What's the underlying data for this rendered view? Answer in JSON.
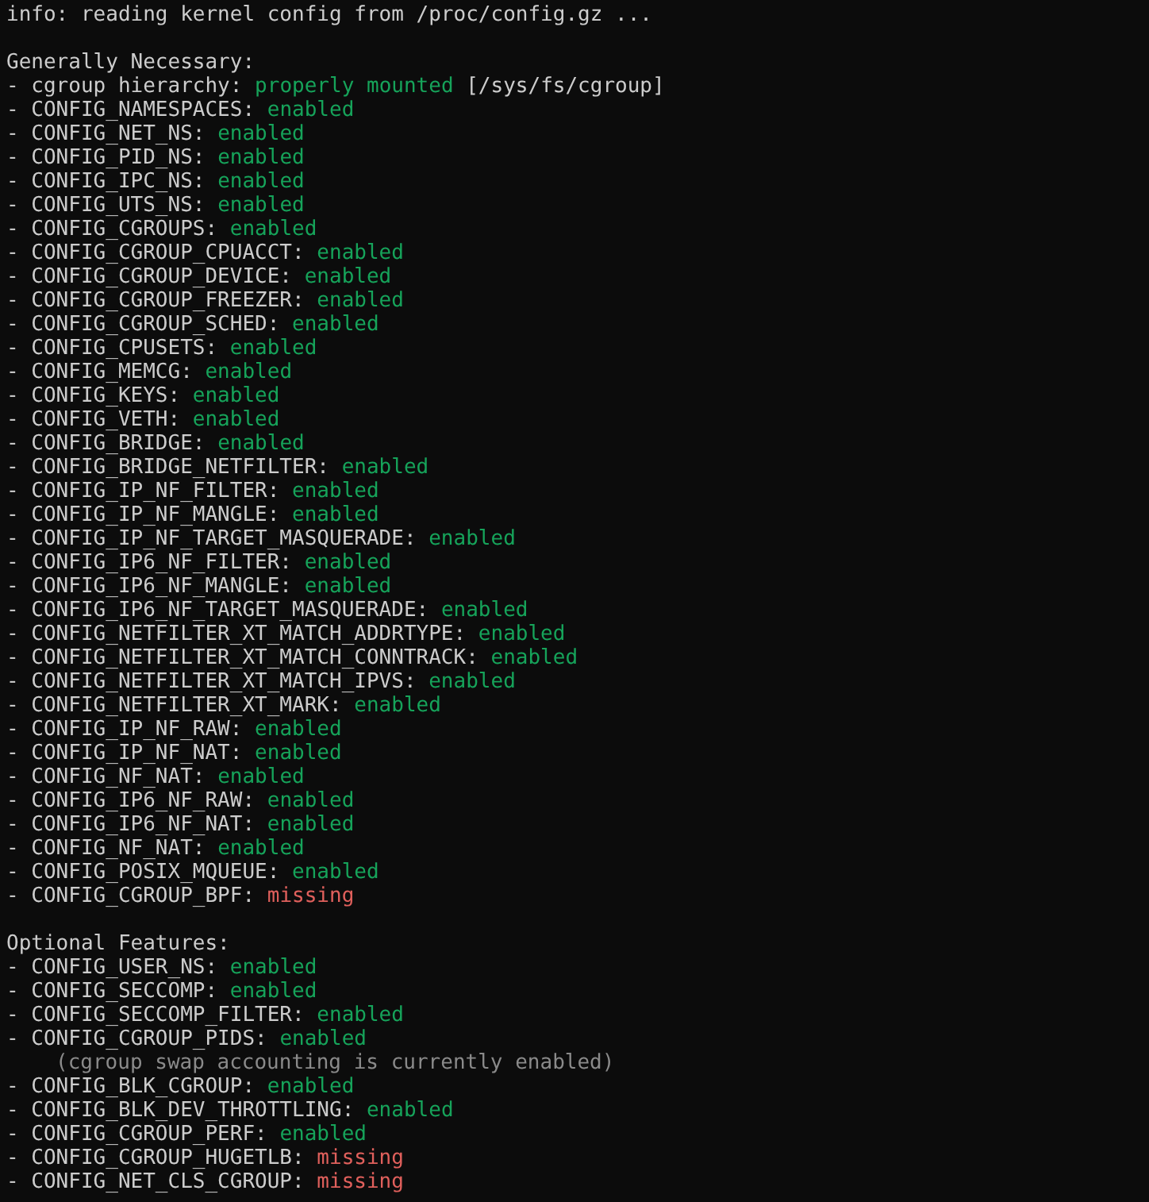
{
  "info": "info: reading kernel config from /proc/config.gz ...",
  "sections": [
    {
      "heading": "Generally Necessary:",
      "items": [
        {
          "kind": "check",
          "label": "- cgroup hierarchy:",
          "status": "properly mounted",
          "ok": true,
          "suffix": "[/sys/fs/cgroup]"
        },
        {
          "kind": "check",
          "label": "- CONFIG_NAMESPACES:",
          "status": "enabled",
          "ok": true
        },
        {
          "kind": "check",
          "label": "- CONFIG_NET_NS:",
          "status": "enabled",
          "ok": true
        },
        {
          "kind": "check",
          "label": "- CONFIG_PID_NS:",
          "status": "enabled",
          "ok": true
        },
        {
          "kind": "check",
          "label": "- CONFIG_IPC_NS:",
          "status": "enabled",
          "ok": true
        },
        {
          "kind": "check",
          "label": "- CONFIG_UTS_NS:",
          "status": "enabled",
          "ok": true
        },
        {
          "kind": "check",
          "label": "- CONFIG_CGROUPS:",
          "status": "enabled",
          "ok": true
        },
        {
          "kind": "check",
          "label": "- CONFIG_CGROUP_CPUACCT:",
          "status": "enabled",
          "ok": true
        },
        {
          "kind": "check",
          "label": "- CONFIG_CGROUP_DEVICE:",
          "status": "enabled",
          "ok": true
        },
        {
          "kind": "check",
          "label": "- CONFIG_CGROUP_FREEZER:",
          "status": "enabled",
          "ok": true
        },
        {
          "kind": "check",
          "label": "- CONFIG_CGROUP_SCHED:",
          "status": "enabled",
          "ok": true
        },
        {
          "kind": "check",
          "label": "- CONFIG_CPUSETS:",
          "status": "enabled",
          "ok": true
        },
        {
          "kind": "check",
          "label": "- CONFIG_MEMCG:",
          "status": "enabled",
          "ok": true
        },
        {
          "kind": "check",
          "label": "- CONFIG_KEYS:",
          "status": "enabled",
          "ok": true
        },
        {
          "kind": "check",
          "label": "- CONFIG_VETH:",
          "status": "enabled",
          "ok": true
        },
        {
          "kind": "check",
          "label": "- CONFIG_BRIDGE:",
          "status": "enabled",
          "ok": true
        },
        {
          "kind": "check",
          "label": "- CONFIG_BRIDGE_NETFILTER:",
          "status": "enabled",
          "ok": true
        },
        {
          "kind": "check",
          "label": "- CONFIG_IP_NF_FILTER:",
          "status": "enabled",
          "ok": true
        },
        {
          "kind": "check",
          "label": "- CONFIG_IP_NF_MANGLE:",
          "status": "enabled",
          "ok": true
        },
        {
          "kind": "check",
          "label": "- CONFIG_IP_NF_TARGET_MASQUERADE:",
          "status": "enabled",
          "ok": true
        },
        {
          "kind": "check",
          "label": "- CONFIG_IP6_NF_FILTER:",
          "status": "enabled",
          "ok": true
        },
        {
          "kind": "check",
          "label": "- CONFIG_IP6_NF_MANGLE:",
          "status": "enabled",
          "ok": true
        },
        {
          "kind": "check",
          "label": "- CONFIG_IP6_NF_TARGET_MASQUERADE:",
          "status": "enabled",
          "ok": true
        },
        {
          "kind": "check",
          "label": "- CONFIG_NETFILTER_XT_MATCH_ADDRTYPE:",
          "status": "enabled",
          "ok": true
        },
        {
          "kind": "check",
          "label": "- CONFIG_NETFILTER_XT_MATCH_CONNTRACK:",
          "status": "enabled",
          "ok": true
        },
        {
          "kind": "check",
          "label": "- CONFIG_NETFILTER_XT_MATCH_IPVS:",
          "status": "enabled",
          "ok": true
        },
        {
          "kind": "check",
          "label": "- CONFIG_NETFILTER_XT_MARK:",
          "status": "enabled",
          "ok": true
        },
        {
          "kind": "check",
          "label": "- CONFIG_IP_NF_RAW:",
          "status": "enabled",
          "ok": true
        },
        {
          "kind": "check",
          "label": "- CONFIG_IP_NF_NAT:",
          "status": "enabled",
          "ok": true
        },
        {
          "kind": "check",
          "label": "- CONFIG_NF_NAT:",
          "status": "enabled",
          "ok": true
        },
        {
          "kind": "check",
          "label": "- CONFIG_IP6_NF_RAW:",
          "status": "enabled",
          "ok": true
        },
        {
          "kind": "check",
          "label": "- CONFIG_IP6_NF_NAT:",
          "status": "enabled",
          "ok": true
        },
        {
          "kind": "check",
          "label": "- CONFIG_NF_NAT:",
          "status": "enabled",
          "ok": true
        },
        {
          "kind": "check",
          "label": "- CONFIG_POSIX_MQUEUE:",
          "status": "enabled",
          "ok": true
        },
        {
          "kind": "check",
          "label": "- CONFIG_CGROUP_BPF:",
          "status": "missing",
          "ok": false
        }
      ]
    },
    {
      "heading": "Optional Features:",
      "items": [
        {
          "kind": "check",
          "label": "- CONFIG_USER_NS:",
          "status": "enabled",
          "ok": true
        },
        {
          "kind": "check",
          "label": "- CONFIG_SECCOMP:",
          "status": "enabled",
          "ok": true
        },
        {
          "kind": "check",
          "label": "- CONFIG_SECCOMP_FILTER:",
          "status": "enabled",
          "ok": true
        },
        {
          "kind": "check",
          "label": "- CONFIG_CGROUP_PIDS:",
          "status": "enabled",
          "ok": true
        },
        {
          "kind": "note",
          "label": "(cgroup swap accounting is currently enabled)"
        },
        {
          "kind": "check",
          "label": "- CONFIG_BLK_CGROUP:",
          "status": "enabled",
          "ok": true
        },
        {
          "kind": "check",
          "label": "- CONFIG_BLK_DEV_THROTTLING:",
          "status": "enabled",
          "ok": true
        },
        {
          "kind": "check",
          "label": "- CONFIG_CGROUP_PERF:",
          "status": "enabled",
          "ok": true
        },
        {
          "kind": "check",
          "label": "- CONFIG_CGROUP_HUGETLB:",
          "status": "missing",
          "ok": false
        },
        {
          "kind": "check",
          "label": "- CONFIG_NET_CLS_CGROUP:",
          "status": "missing",
          "ok": false
        }
      ]
    }
  ]
}
